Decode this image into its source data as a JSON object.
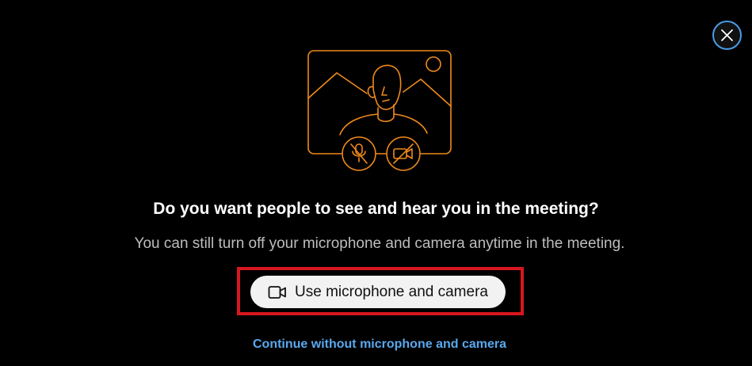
{
  "dialog": {
    "heading": "Do you want people to see and hear you in the meeting?",
    "subtext": "You can still turn off your microphone and camera anytime in the meeting.",
    "primary_button_label": "Use microphone and camera",
    "secondary_link_label": "Continue without microphone and camera"
  },
  "icons": {
    "close": "close-icon",
    "camera": "video-camera-icon",
    "illustration": "person-video-illustration",
    "mic_off": "microphone-off-icon",
    "camera_off": "camera-off-icon"
  },
  "colors": {
    "background": "#000000",
    "illustration_accent": "#f08a1c",
    "link": "#5aa8ee",
    "close_ring": "#4a9de8",
    "highlight": "#d8161f",
    "button_bg": "#f2f2f2"
  }
}
